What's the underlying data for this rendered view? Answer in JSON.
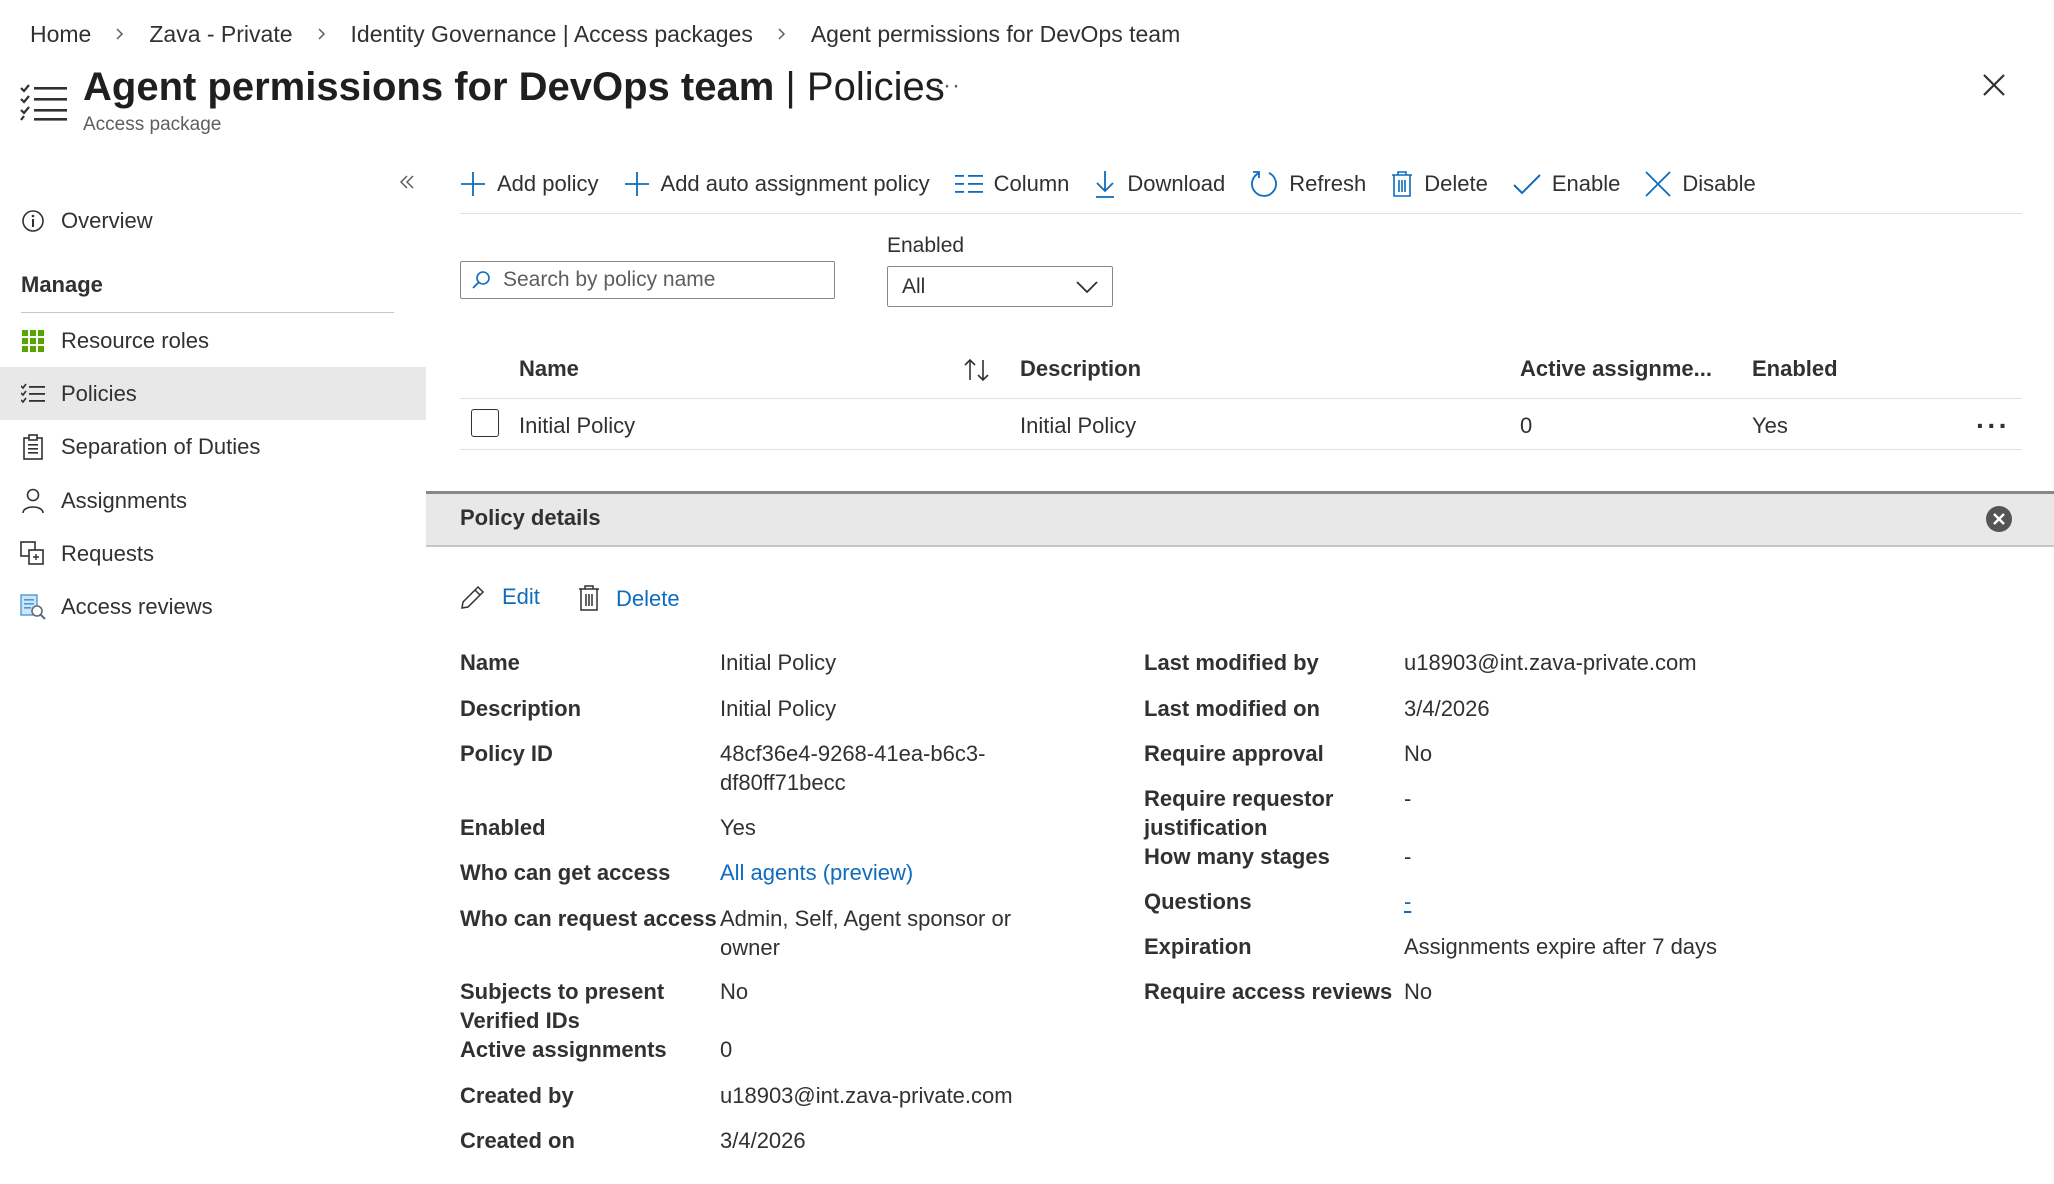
{
  "breadcrumb": [
    "Home",
    "Zava - Private",
    "Identity Governance | Access packages",
    "Agent permissions for DevOps team"
  ],
  "header": {
    "title_bold": "Agent permissions for DevOps team",
    "title_sep": " | ",
    "title_section": "Policies",
    "subtitle": "Access package",
    "more": "···"
  },
  "sidebar": {
    "collapse": "«",
    "overview": "Overview",
    "manage_label": "Manage",
    "items": [
      {
        "label": "Resource roles",
        "icon": "grid-icon"
      },
      {
        "label": "Policies",
        "icon": "list-icon",
        "active": true
      },
      {
        "label": "Separation of Duties",
        "icon": "clipboard-icon"
      },
      {
        "label": "Assignments",
        "icon": "person-icon"
      },
      {
        "label": "Requests",
        "icon": "requests-icon"
      },
      {
        "label": "Access reviews",
        "icon": "review-icon"
      }
    ]
  },
  "toolbar": {
    "add_policy": "Add policy",
    "add_auto": "Add auto assignment policy",
    "column": "Column",
    "download": "Download",
    "refresh": "Refresh",
    "delete": "Delete",
    "enable": "Enable",
    "disable": "Disable"
  },
  "filters": {
    "search_placeholder": "Search by policy name",
    "enabled_label": "Enabled",
    "enabled_value": "All"
  },
  "table": {
    "columns": [
      "Name",
      "Description",
      "Active assignme...",
      "Enabled"
    ],
    "rows": [
      {
        "name": "Initial Policy",
        "description": "Initial Policy",
        "active": "0",
        "enabled": "Yes"
      }
    ],
    "row_more": "···"
  },
  "details": {
    "title": "Policy details",
    "edit": "Edit",
    "delete": "Delete",
    "left": {
      "name_label": "Name",
      "name_value": "Initial Policy",
      "desc_label": "Description",
      "desc_value": "Initial Policy",
      "id_label": "Policy ID",
      "id_value_1": "48cf36e4-9268-41ea-b6c3-",
      "id_value_2": "df80ff71becc",
      "enabled_label": "Enabled",
      "enabled_value": "Yes",
      "who_get_label": "Who can get access",
      "who_get_value": "All agents (preview)",
      "who_req_label": "Who can request access",
      "who_req_value_1": "Admin, Self, Agent sponsor or",
      "who_req_value_2": "owner",
      "subjects_label_1": "Subjects to present",
      "subjects_label_2": "Verified IDs",
      "subjects_value": "No",
      "active_label": "Active assignments",
      "active_value": "0",
      "created_by_label": "Created by",
      "created_by_value": "u18903@int.zava-private.com",
      "created_on_label": "Created on",
      "created_on_value": "3/4/2026"
    },
    "right": {
      "mod_by_label": "Last modified by",
      "mod_by_value": "u18903@int.zava-private.com",
      "mod_on_label": "Last modified on",
      "mod_on_value": "3/4/2026",
      "approval_label": "Require approval",
      "approval_value": "No",
      "justif_label_1": "Require requestor",
      "justif_label_2": "justification",
      "justif_value": "-",
      "stages_label": "How many stages",
      "stages_value": "-",
      "questions_label": "Questions",
      "questions_value": "-",
      "expiration_label": "Expiration",
      "expiration_value": "Assignments expire after 7 days",
      "reviews_label": "Require access reviews",
      "reviews_value": "No"
    }
  }
}
